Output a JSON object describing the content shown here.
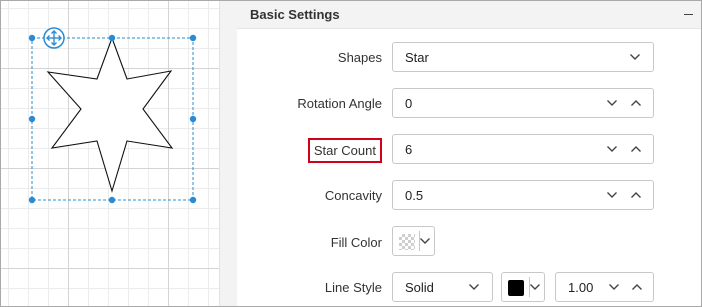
{
  "canvas": {
    "shape": "star",
    "star_count": 6,
    "move_handle_icon": "move-arrows-icon",
    "accent_color": "#2a8bd5"
  },
  "panel": {
    "title": "Basic Settings",
    "collapse_icon": "minus-icon",
    "shapes": {
      "label": "Shapes",
      "value": "Star"
    },
    "rotation_angle": {
      "label": "Rotation Angle",
      "value": "0"
    },
    "star_count": {
      "label": "Star Count",
      "value": "6"
    },
    "concavity": {
      "label": "Concavity",
      "value": "0.5"
    },
    "fill_color": {
      "label": "Fill Color",
      "value_icon": "transparent-swatch"
    },
    "line_style": {
      "label": "Line Style",
      "style": "Solid",
      "color": "#000000",
      "width": "1.00"
    }
  }
}
